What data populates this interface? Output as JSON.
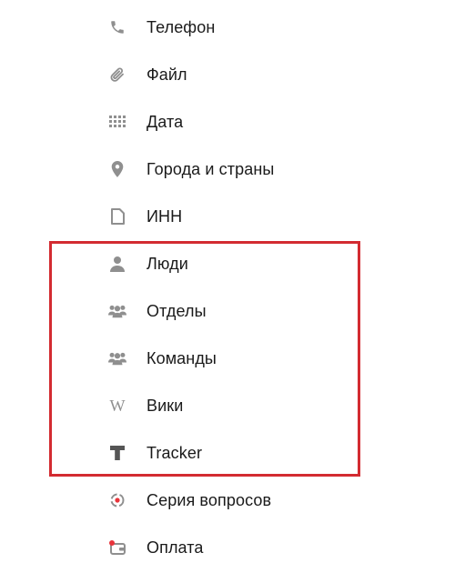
{
  "menu": {
    "items": [
      {
        "label": "Телефон",
        "icon": "phone-icon"
      },
      {
        "label": "Файл",
        "icon": "paperclip-icon"
      },
      {
        "label": "Дата",
        "icon": "grid-icon"
      },
      {
        "label": "Города и страны",
        "icon": "map-pin-icon"
      },
      {
        "label": "ИНН",
        "icon": "document-icon"
      },
      {
        "label": "Люди",
        "icon": "person-icon"
      },
      {
        "label": "Отделы",
        "icon": "group-icon"
      },
      {
        "label": "Команды",
        "icon": "group-icon"
      },
      {
        "label": "Вики",
        "icon": "wiki-w-icon",
        "glyph": "W"
      },
      {
        "label": "Tracker",
        "icon": "tracker-t-icon"
      },
      {
        "label": "Серия вопросов",
        "icon": "series-circle-icon"
      },
      {
        "label": "Оплата",
        "icon": "wallet-icon"
      }
    ]
  },
  "highlight": {
    "color": "#d32b31",
    "covers": [
      "Люди",
      "Отделы",
      "Команды",
      "Вики",
      "Tracker"
    ]
  },
  "colors": {
    "icon_gray": "#8f8f8f",
    "text": "#1a1a1a",
    "accent_red": "#e8343b"
  }
}
